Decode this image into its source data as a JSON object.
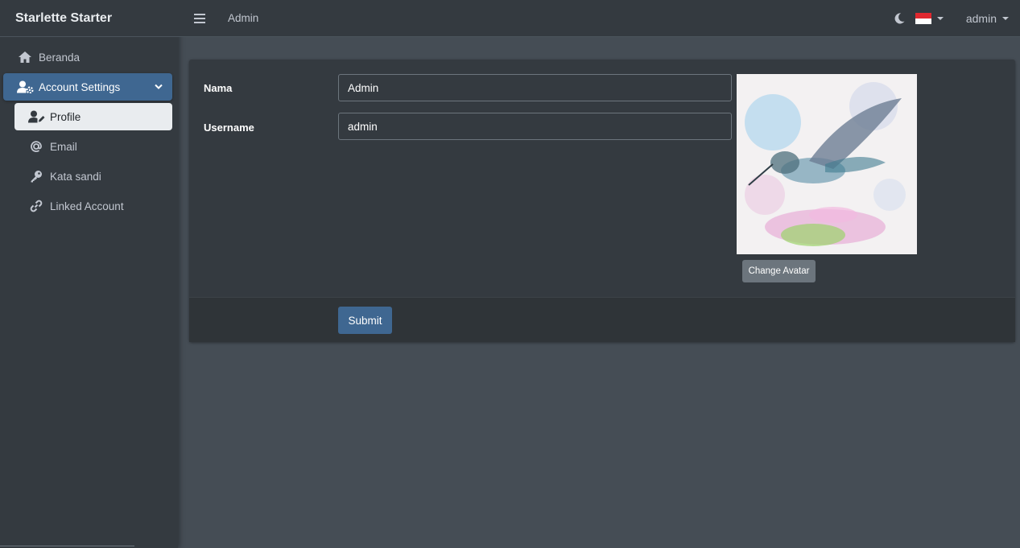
{
  "brand": "Starlette Starter",
  "sidebar": {
    "items": [
      {
        "label": "Beranda",
        "icon": "home-icon"
      },
      {
        "label": "Account Settings",
        "icon": "user-cog-icon",
        "expanded": true
      },
      {
        "label": "Profile",
        "icon": "user-edit-icon",
        "active": true
      },
      {
        "label": "Email",
        "icon": "at-icon"
      },
      {
        "label": "Kata sandi",
        "icon": "key-icon"
      },
      {
        "label": "Linked Account",
        "icon": "link-icon"
      }
    ]
  },
  "topbar": {
    "title": "Admin",
    "language_flag": "indonesia-flag-icon",
    "user_label": "admin"
  },
  "form": {
    "name_label": "Nama",
    "name_value": "Admin",
    "username_label": "Username",
    "username_value": "admin",
    "change_avatar_label": "Change Avatar",
    "submit_label": "Submit"
  },
  "colors": {
    "sidebar_bg": "#343a40",
    "content_bg": "#454d55",
    "accent": "#3f6791",
    "secondary": "#6c757d"
  }
}
